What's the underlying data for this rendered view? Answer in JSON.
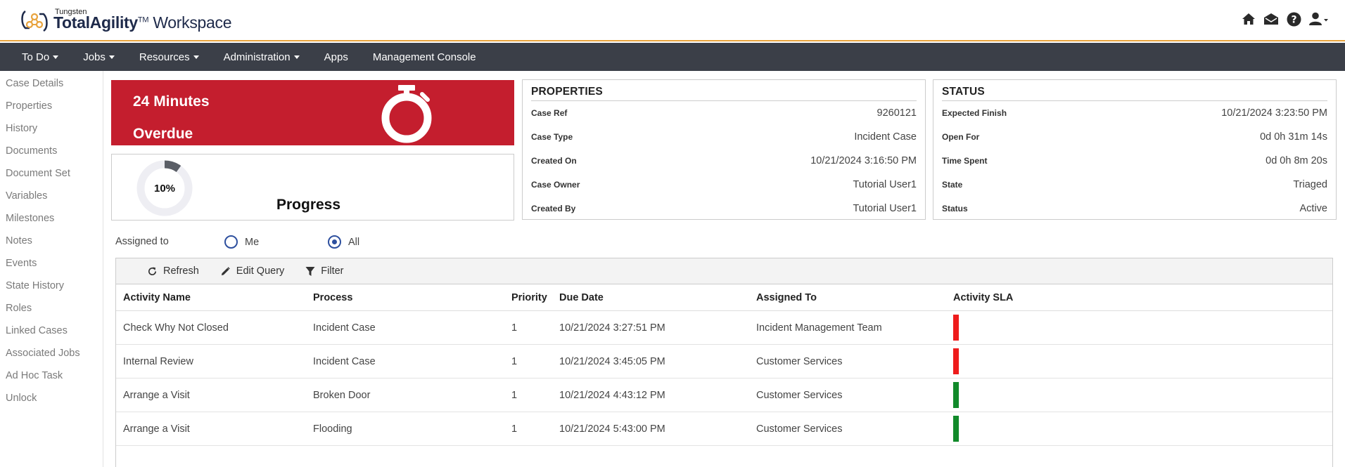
{
  "header": {
    "brand": "Tungsten",
    "product": "TotalAgility",
    "tm": "TM",
    "workspace": "Workspace"
  },
  "nav": [
    {
      "label": "To Do",
      "dropdown": true
    },
    {
      "label": "Jobs",
      "dropdown": true
    },
    {
      "label": "Resources",
      "dropdown": true
    },
    {
      "label": "Administration",
      "dropdown": true
    },
    {
      "label": "Apps",
      "dropdown": false
    },
    {
      "label": "Management Console",
      "dropdown": false
    }
  ],
  "sidebar": [
    "Case Details",
    "Properties",
    "History",
    "Documents",
    "Document Set",
    "Variables",
    "Milestones",
    "Notes",
    "Events",
    "State History",
    "Roles",
    "Linked Cases",
    "Associated Jobs",
    "Ad Hoc Task",
    "Unlock"
  ],
  "overdue": {
    "line1": "24 Minutes",
    "line2": "Overdue",
    "color": "#c41e2e"
  },
  "progress": {
    "percent": 10,
    "percent_label": "10%",
    "title": "Progress"
  },
  "properties": {
    "title": "PROPERTIES",
    "rows": [
      {
        "key": "Case Ref",
        "value": "9260121"
      },
      {
        "key": "Case Type",
        "value": "Incident Case"
      },
      {
        "key": "Created On",
        "value": "10/21/2024 3:16:50 PM"
      },
      {
        "key": "Case Owner",
        "value": "Tutorial User1"
      },
      {
        "key": "Created By",
        "value": "Tutorial User1"
      }
    ]
  },
  "status": {
    "title": "STATUS",
    "rows": [
      {
        "key": "Expected Finish",
        "value": "10/21/2024 3:23:50 PM"
      },
      {
        "key": "Open For",
        "value": "0d 0h 31m 14s"
      },
      {
        "key": "Time Spent",
        "value": "0d 0h 8m 20s"
      },
      {
        "key": "State",
        "value": "Triaged"
      },
      {
        "key": "Status",
        "value": "Active"
      }
    ]
  },
  "assigned": {
    "label": "Assigned to",
    "options": [
      "Me",
      "All"
    ],
    "selected": "All"
  },
  "toolbar": {
    "refresh": "Refresh",
    "edit_query": "Edit Query",
    "filter": "Filter"
  },
  "table": {
    "columns": [
      "Activity Name",
      "Process",
      "Priority",
      "Due Date",
      "Assigned To",
      "Activity SLA"
    ],
    "rows": [
      {
        "activity": "Check Why Not Closed",
        "process": "Incident Case",
        "priority": "1",
        "due": "10/21/2024 3:27:51 PM",
        "assigned": "Incident Management Team",
        "sla_color": "#ee1c1c"
      },
      {
        "activity": "Internal Review",
        "process": "Incident Case",
        "priority": "1",
        "due": "10/21/2024 3:45:05 PM",
        "assigned": "Customer Services",
        "sla_color": "#ee1c1c"
      },
      {
        "activity": "Arrange a Visit",
        "process": "Broken Door",
        "priority": "1",
        "due": "10/21/2024 4:43:12 PM",
        "assigned": "Customer Services",
        "sla_color": "#118a2a"
      },
      {
        "activity": "Arrange a Visit",
        "process": "Flooding",
        "priority": "1",
        "due": "10/21/2024 5:43:00 PM",
        "assigned": "Customer Services",
        "sla_color": "#118a2a"
      }
    ]
  },
  "colors": {
    "nav_bg": "#3b3f48",
    "accent": "#e8a33d",
    "radio": "#2d4f9e"
  }
}
